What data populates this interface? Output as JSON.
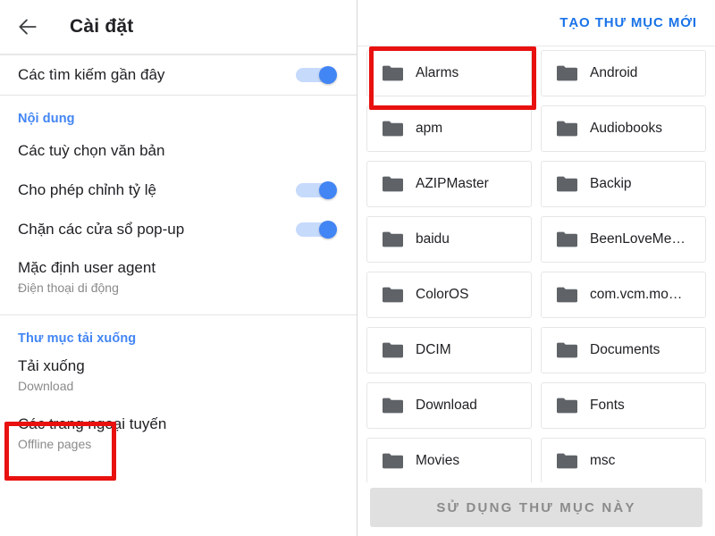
{
  "left_panel": {
    "appbar": {
      "back_icon": "arrow-left-icon",
      "title": "Cài đặt"
    },
    "rows": [
      {
        "title": "Các tìm kiếm gần đây",
        "subtitle": "",
        "toggle": true,
        "toggle_on": true
      }
    ],
    "sections": [
      {
        "header": "Nội dung",
        "rows": [
          {
            "title": "Các tuỳ chọn văn bản",
            "subtitle": "",
            "toggle": false,
            "toggle_on": false
          },
          {
            "title": "Cho phép chỉnh tỷ lệ",
            "subtitle": "",
            "toggle": true,
            "toggle_on": true
          },
          {
            "title": "Chặn các cửa sổ pop-up",
            "subtitle": "",
            "toggle": true,
            "toggle_on": true
          },
          {
            "title": "Mặc định user agent",
            "subtitle": "Điện thoại di động",
            "toggle": false,
            "toggle_on": false
          }
        ]
      },
      {
        "header": "Thư mục tải xuống",
        "rows": [
          {
            "title": "Tải xuống",
            "subtitle": "Download",
            "toggle": false,
            "toggle_on": false
          },
          {
            "title": "Các trang ngoại tuyến",
            "subtitle": "Offline pages",
            "toggle": false,
            "toggle_on": false
          }
        ]
      }
    ]
  },
  "right_panel": {
    "topbar": {
      "new_folder_label": "TẠO THƯ MỤC MỚI"
    },
    "folders": [
      {
        "name": "Alarms",
        "icon": "folder-icon"
      },
      {
        "name": "Android",
        "icon": "folder-icon"
      },
      {
        "name": "apm",
        "icon": "folder-icon"
      },
      {
        "name": "Audiobooks",
        "icon": "folder-icon"
      },
      {
        "name": "AZIPMaster",
        "icon": "folder-icon"
      },
      {
        "name": "Backip",
        "icon": "folder-icon"
      },
      {
        "name": "baidu",
        "icon": "folder-icon"
      },
      {
        "name": "BeenLoveMe…",
        "icon": "folder-icon"
      },
      {
        "name": "ColorOS",
        "icon": "folder-icon"
      },
      {
        "name": "com.vcm.mo…",
        "icon": "folder-icon"
      },
      {
        "name": "DCIM",
        "icon": "folder-icon"
      },
      {
        "name": "Documents",
        "icon": "folder-icon"
      },
      {
        "name": "Download",
        "icon": "folder-icon"
      },
      {
        "name": "Fonts",
        "icon": "folder-icon"
      },
      {
        "name": "Movies",
        "icon": "folder-icon"
      },
      {
        "name": "msc",
        "icon": "folder-icon"
      }
    ],
    "use_folder_label": "SỬ DỤNG THƯ MỤC NÀY"
  },
  "annotations": {
    "highlight_left": {
      "target": "Tải xuống"
    },
    "highlight_right": {
      "target": "Alarms"
    }
  },
  "colors": {
    "accent_blue": "#4285f4",
    "link_blue": "#1a73e8",
    "annotation_red": "#e8110f",
    "folder_gray": "#5f6368",
    "disabled_gray": "#e0e0e0"
  }
}
